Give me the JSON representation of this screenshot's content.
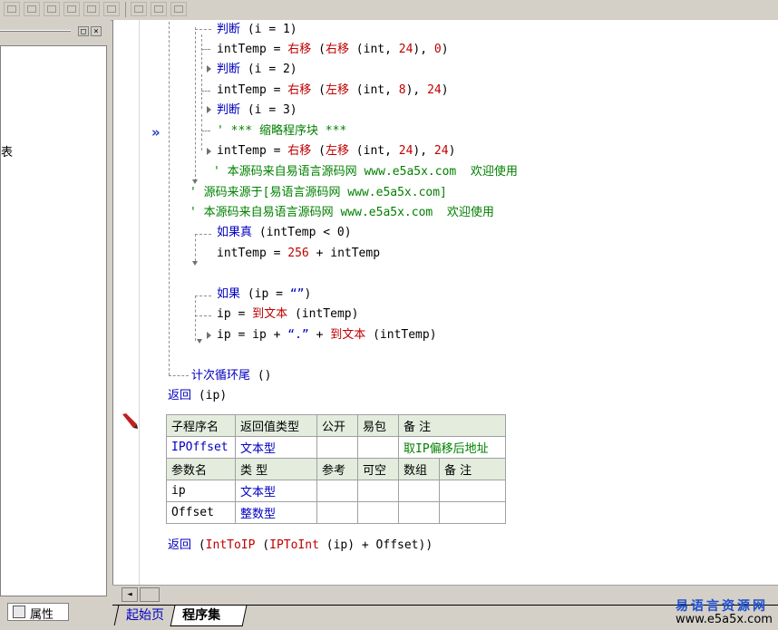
{
  "code": {
    "l1": {
      "kw": "判断",
      "rest": " (i = 1)"
    },
    "l2": {
      "a": "intTemp = ",
      "fn1": "右移",
      "b": " (",
      "fn2": "右移",
      "c": " (int, ",
      "n1": "24",
      "d": "), ",
      "n2": "0",
      "e": ")"
    },
    "l3": {
      "kw": "判断",
      "rest": " (i = 2)"
    },
    "l4": {
      "a": "intTemp = ",
      "fn1": "右移",
      "b": " (",
      "fn2": "左移",
      "c": " (int, ",
      "n1": "8",
      "d": "), ",
      "n2": "24",
      "e": ")"
    },
    "l5": {
      "kw": "判断",
      "rest": " (i = 3)"
    },
    "l6": {
      "text": "' *** 缩略程序块 ***"
    },
    "l7": {
      "a": "intTemp = ",
      "fn1": "右移",
      "b": " (",
      "fn2": "左移",
      "c": " (int, ",
      "n1": "24",
      "d": "), ",
      "n2": "24",
      "e": ")"
    },
    "l8": {
      "text": "' 本源码来自易语言源码网 www.e5a5x.com  欢迎使用"
    },
    "l9": {
      "text": "' 源码来源于[易语言源码网 www.e5a5x.com]"
    },
    "l10": {
      "text": "' 本源码来自易语言源码网 www.e5a5x.com  欢迎使用"
    },
    "l11": {
      "kw": "如果真",
      "rest": " (intTemp < 0)"
    },
    "l12": {
      "a": "intTemp = ",
      "n1": "256",
      "b": " + intTemp"
    },
    "l13": {
      "kw": "如果",
      "rest": " (ip = ",
      "str": "“”",
      "end": ")"
    },
    "l14": {
      "a": "ip = ",
      "fn": "到文本",
      "b": " (intTemp)"
    },
    "l15": {
      "a": "ip = ip + ",
      "str": "“.”",
      "b": " + ",
      "fn": "到文本",
      "c": " (intTemp)"
    },
    "l16": {
      "kw": "计次循环尾",
      "rest": " ()"
    },
    "l17": {
      "kw": "返回",
      "rest": " (ip)"
    },
    "l18": {
      "kw": "返回",
      "a": " (",
      "fn1": "IntToIP",
      "b": " (",
      "fn2": "IPToInt",
      "c": " (ip) + Offset))"
    }
  },
  "sub_table": {
    "headers": [
      "子程序名",
      "返回值类型",
      "公开",
      "易包",
      "备 注"
    ],
    "row": {
      "name": "IPOffset",
      "type": "文本型",
      "public": "",
      "pkg": "",
      "note": "取IP偏移后地址"
    },
    "param_headers": [
      "参数名",
      "类 型",
      "参考",
      "可空",
      "数组",
      "备 注"
    ],
    "params": [
      {
        "name": "ip",
        "type": "文本型"
      },
      {
        "name": "Offset",
        "type": "整数型"
      }
    ]
  },
  "left_panel": {
    "label_fragment": "表",
    "tab_label": "属性",
    "min_button": "□",
    "close_button": "×"
  },
  "tabs": {
    "start_page": "起始页",
    "program_set": "程序集"
  },
  "scroll": {
    "left_arrow": "◄"
  },
  "watermark": {
    "name": "易语言资源网",
    "url": "www.e5a5x.com"
  },
  "colors": {
    "keyword": "#0000c0",
    "comment": "#008000",
    "number": "#c00000",
    "header_bg": "#e4ecde"
  }
}
